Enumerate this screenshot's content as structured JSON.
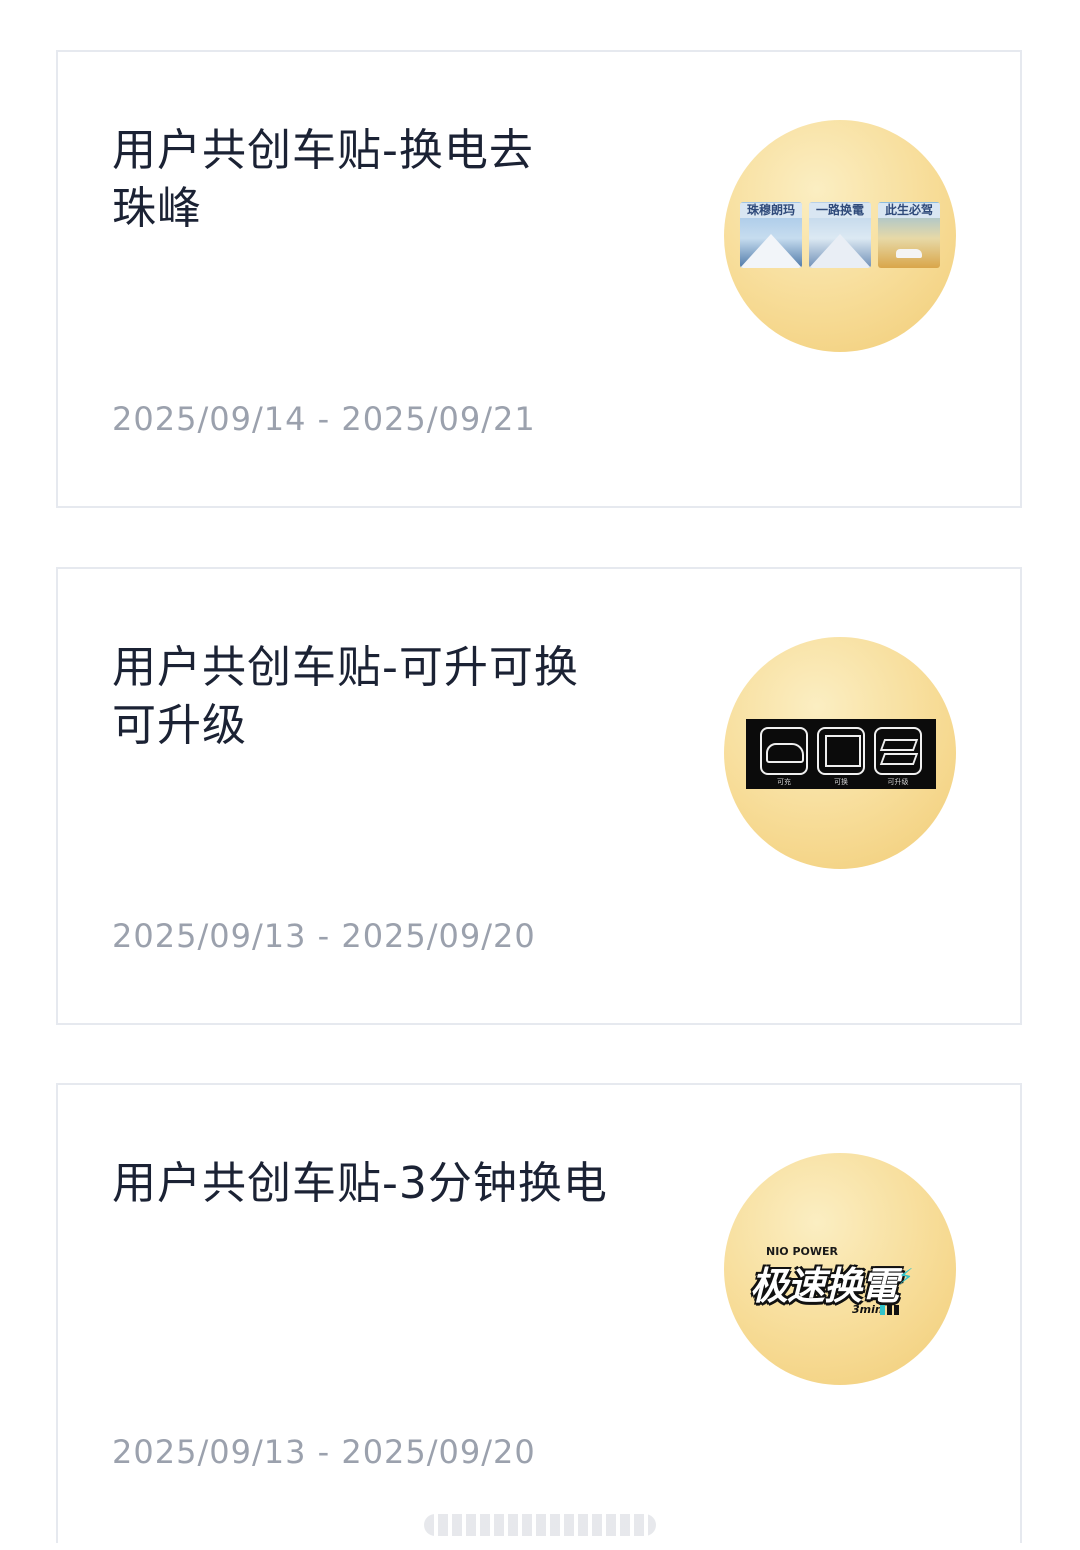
{
  "cards": [
    {
      "title": "用户共创车贴-换电去\n珠峰",
      "date": "2025/09/14 - 2025/09/21",
      "sticker": {
        "posters": [
          "珠穆朗玛",
          "一路换電",
          "此生必驾"
        ]
      }
    },
    {
      "title": "用户共创车贴-可升可换\n可升级",
      "date": "2025/09/13 - 2025/09/20",
      "sticker": {
        "captions": [
          "可充",
          "可换",
          "可升级"
        ]
      }
    },
    {
      "title": "用户共创车贴-3分钟换电",
      "date": "2025/09/13 - 2025/09/20",
      "sticker": {
        "brand": "NIO POWER",
        "headline": "极速换電",
        "sub": "3min"
      }
    }
  ]
}
